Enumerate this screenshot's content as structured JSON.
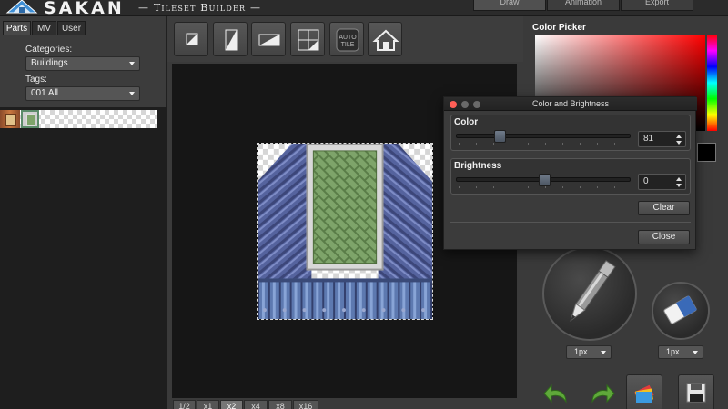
{
  "app": {
    "brand": "SAKAN",
    "subtitle": "— Tileset Builder —"
  },
  "top_tabs": [
    {
      "label": "Draw",
      "active": true
    },
    {
      "label": "Animation",
      "active": false
    },
    {
      "label": "Export",
      "active": false
    }
  ],
  "parts_panel": {
    "tabs": [
      {
        "label": "Parts",
        "active": true
      },
      {
        "label": "MV",
        "active": false
      },
      {
        "label": "User",
        "active": false
      }
    ],
    "categories_label": "Categories:",
    "categories_value": "Buildings",
    "tags_label": "Tags:",
    "tags_value": "001 All"
  },
  "toolbar": {
    "tools": [
      {
        "icon": "single-tile-icon"
      },
      {
        "icon": "vertical-tile-icon"
      },
      {
        "icon": "horizontal-tile-icon"
      },
      {
        "icon": "grid-tile-icon"
      },
      {
        "icon": "auto-tile-icon",
        "label": "AUTO TILE"
      },
      {
        "icon": "house-icon"
      }
    ]
  },
  "zoom": {
    "buttons": [
      {
        "label": "1/2",
        "active": false
      },
      {
        "label": "x1",
        "active": false
      },
      {
        "label": "x2",
        "active": true
      },
      {
        "label": "x4",
        "active": false
      },
      {
        "label": "x8",
        "active": false
      },
      {
        "label": "x16",
        "active": false
      }
    ]
  },
  "color_picker": {
    "title": "Color Picker",
    "selected_color": "#000000",
    "hue": "#ff0000"
  },
  "brushes": {
    "pen_size": "1px",
    "eraser_size": "1px"
  },
  "dialog": {
    "title": "Color and Brightness",
    "color_label": "Color",
    "color_value": "81",
    "color_slider_fraction": 0.24,
    "brightness_label": "Brightness",
    "brightness_value": "0",
    "brightness_slider_fraction": 0.5,
    "clear_label": "Clear",
    "close_label": "Close"
  },
  "colors": {
    "accent_dialog_red": "#ff5f57",
    "panel_bg": "#3a3a3a",
    "canvas_bg": "#161616"
  }
}
